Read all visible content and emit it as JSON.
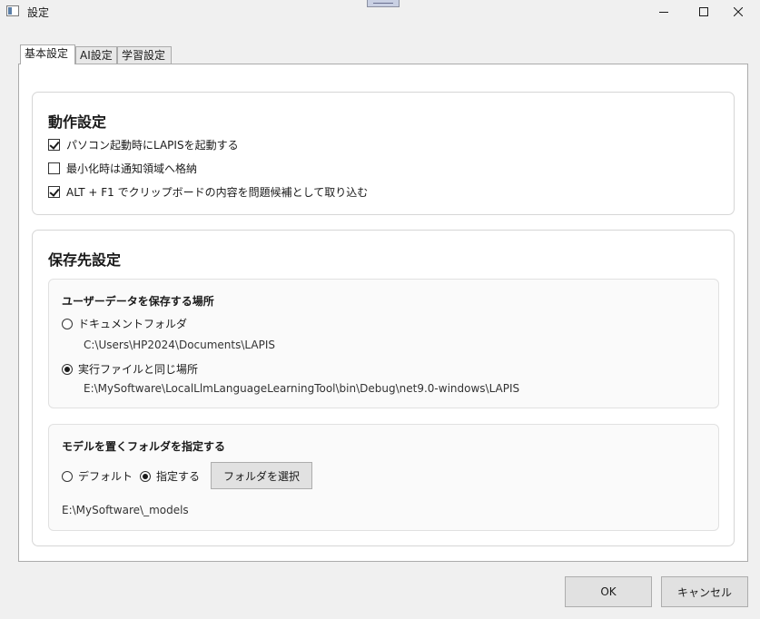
{
  "window": {
    "title": "設定",
    "icon": "app-window-icon",
    "controls": {
      "minimize": "minimize-icon",
      "maximize": "maximize-icon",
      "close": "close-icon"
    }
  },
  "tabs": [
    {
      "label": "基本設定",
      "active": true
    },
    {
      "label": "AI設定",
      "active": false
    },
    {
      "label": "学習設定",
      "active": false
    }
  ],
  "behavior": {
    "title": "動作設定",
    "options": [
      {
        "label": "パソコン起動時にLAPISを起動する",
        "checked": true
      },
      {
        "label": "最小化時は通知領域へ格納",
        "checked": false
      },
      {
        "label": "ALT + F1 でクリップボードの内容を問題候補として取り込む",
        "checked": true
      }
    ]
  },
  "storage": {
    "title": "保存先設定",
    "user_data": {
      "title": "ユーザーデータを保存する場所",
      "options": [
        {
          "label": "ドキュメントフォルダ",
          "path": "C:\\Users\\HP2024\\Documents\\LAPIS",
          "selected": false
        },
        {
          "label": "実行ファイルと同じ場所",
          "path": "E:\\MySoftware\\LocalLlmLanguageLearningTool\\bin\\Debug\\net9.0-windows\\LAPIS",
          "selected": true
        }
      ]
    },
    "model_folder": {
      "title": "モデルを置くフォルダを指定する",
      "default_label": "デフォルト",
      "specify_label": "指定する",
      "specify_selected": true,
      "select_button": "フォルダを選択",
      "path": "E:\\MySoftware\\_models"
    }
  },
  "footer": {
    "ok": "OK",
    "cancel": "キャンセル"
  }
}
